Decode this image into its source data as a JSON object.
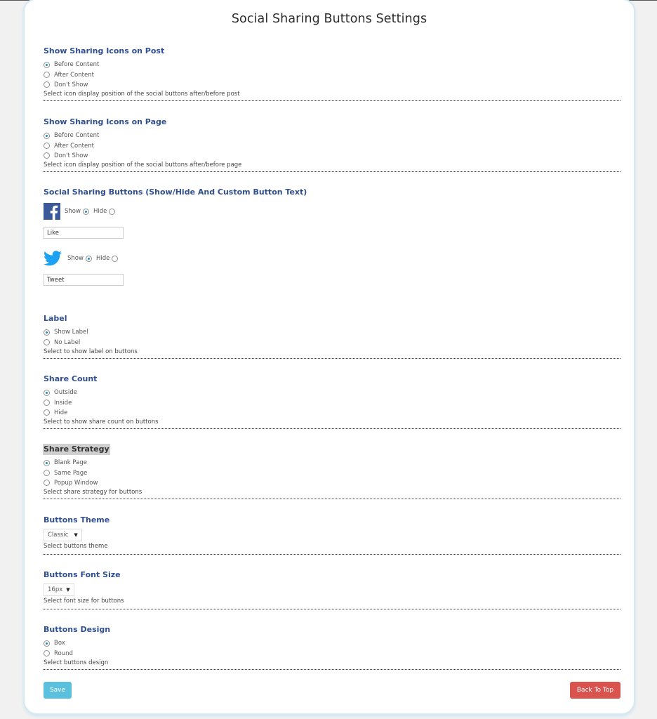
{
  "page": {
    "title": "Social Sharing Buttons Settings"
  },
  "post_icons": {
    "heading": "Show Sharing Icons on Post",
    "options": [
      {
        "label": "Before Content",
        "checked": true
      },
      {
        "label": "After Content",
        "checked": false
      },
      {
        "label": "Don't Show",
        "checked": false
      }
    ],
    "description": "Select icon display position of the social buttons after/before post"
  },
  "page_icons": {
    "heading": "Show Sharing Icons on Page",
    "options": [
      {
        "label": "Before Content",
        "checked": true
      },
      {
        "label": "After Content",
        "checked": false
      },
      {
        "label": "Don't Show",
        "checked": false
      }
    ],
    "description": "Select icon display position of the social buttons after/before page"
  },
  "social_buttons": {
    "heading": "Social Sharing Buttons (Show/Hide And Custom Button Text)",
    "facebook": {
      "icon": "facebook-icon",
      "color": "#3b5998",
      "show_label": "Show",
      "hide_label": "Hide",
      "selected": "show",
      "button_text": "Like"
    },
    "twitter": {
      "icon": "twitter-icon",
      "color": "#1da1f2",
      "show_label": "Show",
      "hide_label": "Hide",
      "selected": "show",
      "button_text": "Tweet"
    }
  },
  "label": {
    "heading": "Label",
    "options": [
      {
        "label": "Show Label",
        "checked": true
      },
      {
        "label": "No Label",
        "checked": false
      }
    ],
    "description": "Select to show label on buttons"
  },
  "share_count": {
    "heading": "Share Count",
    "options": [
      {
        "label": "Outside",
        "checked": true
      },
      {
        "label": "Inside",
        "checked": false
      },
      {
        "label": "Hide",
        "checked": false
      }
    ],
    "description": "Select to show share count on buttons"
  },
  "share_strategy": {
    "heading": "Share Strategy",
    "options": [
      {
        "label": "Blank Page",
        "checked": true
      },
      {
        "label": "Same Page",
        "checked": false
      },
      {
        "label": "Popup Window",
        "checked": false
      }
    ],
    "description": "Select share strategy for buttons"
  },
  "buttons_theme": {
    "heading": "Buttons Theme",
    "selected": "Classic",
    "description": "Select buttons theme"
  },
  "font_size": {
    "heading": "Buttons Font Size",
    "selected": "16px",
    "description": "Select font size for buttons"
  },
  "buttons_design": {
    "heading": "Buttons Design",
    "options": [
      {
        "label": "Box",
        "checked": true
      },
      {
        "label": "Round",
        "checked": false
      }
    ],
    "description": "Select buttons design"
  },
  "actions": {
    "save_label": "Save",
    "back_to_top_label": "Back To Top",
    "save_color": "#5bc0de",
    "back_to_top_color": "#d9534f"
  },
  "colors": {
    "heading": "#2f4f8f",
    "radio_checked": "#1e8cbe"
  }
}
